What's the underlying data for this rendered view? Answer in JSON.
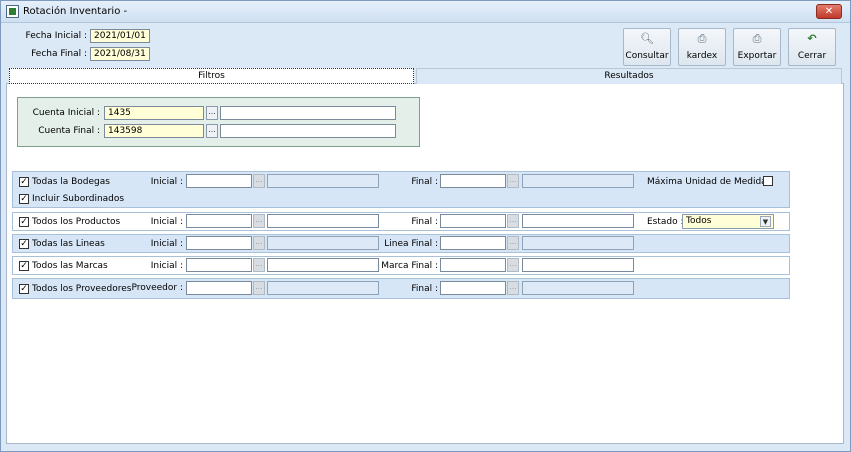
{
  "window": {
    "title": "Rotación Inventario -",
    "close_glyph": "✕"
  },
  "header": {
    "fecha_inicial_label": "Fecha Inicial :",
    "fecha_inicial_value": "2021/01/01",
    "fecha_final_label": "Fecha Final :",
    "fecha_final_value": "2021/08/31"
  },
  "toolbar": {
    "consultar_label": "Consultar",
    "kardex_label": "kardex",
    "exportar_label": "Exportar",
    "cerrar_label": "Cerrar",
    "consultar_icon": "magnifier-icon",
    "kardex_icon": "printer-icon",
    "exportar_icon": "printer-icon",
    "cerrar_icon": "back-arrow-icon"
  },
  "tabs": {
    "filtros": "Filtros",
    "resultados": "Resultados"
  },
  "cuenta": {
    "inicial_label": "Cuenta Inicial :",
    "inicial_value": "1435",
    "final_label": "Cuenta Final :",
    "final_value": "143598"
  },
  "dots_label": "...",
  "filters": {
    "bodegas": {
      "check_label": "Todas la Bodegas",
      "sub_label": "Incluir Subordinados",
      "inicial_label": "Inicial :",
      "final_label": "Final :",
      "max_unidad_label": "Máxima Unidad de Medida"
    },
    "productos": {
      "check_label": "Todos los Productos",
      "inicial_label": "Inicial :",
      "final_label": "Final :",
      "estado_label": "Estado :",
      "estado_value": "Todos"
    },
    "lineas": {
      "check_label": "Todas las Lineas",
      "inicial_label": "Inicial :",
      "final_label": "Linea Final :"
    },
    "marcas": {
      "check_label": "Todos las Marcas",
      "inicial_label": "Inicial :",
      "final_label": "Marca Final :"
    },
    "proveedores": {
      "check_label": "Todos los Proveedores",
      "inicial_label": "Proveedor :",
      "final_label": "Final :"
    }
  },
  "colors": {
    "window_bg": "#dbe8f5",
    "input_yellow": "#fffed6",
    "row_blue": "#d6e6f7",
    "cuenta_green": "#e3efe8",
    "close_red": "#c0392b"
  }
}
